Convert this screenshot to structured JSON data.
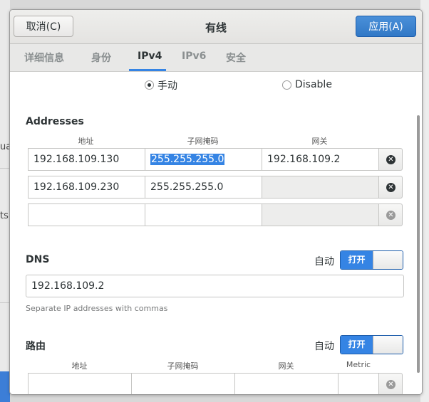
{
  "background": {
    "fragments": [
      "ua",
      "ts"
    ]
  },
  "dialog": {
    "title": "有线",
    "cancel_label": "取消(C)",
    "apply_label": "应用(A)"
  },
  "tabs": [
    {
      "label": "详细信息",
      "active": false
    },
    {
      "label": "身份",
      "active": false
    },
    {
      "label": "IPv4",
      "active": true
    },
    {
      "label": "IPv6",
      "active": false
    },
    {
      "label": "安全",
      "active": false
    }
  ],
  "method": {
    "manual_label": "手动",
    "disable_label": "Disable",
    "selected": "manual"
  },
  "addresses": {
    "title": "Addresses",
    "headers": [
      "地址",
      "子网掩码",
      "网关"
    ],
    "rows": [
      {
        "address": "192.168.109.130",
        "netmask": "255.255.255.0",
        "gateway": "192.168.109.2"
      },
      {
        "address": "192.168.109.230",
        "netmask": "255.255.255.0",
        "gateway": ""
      },
      {
        "address": "",
        "netmask": "",
        "gateway": ""
      }
    ]
  },
  "dns": {
    "title": "DNS",
    "auto_label": "自动",
    "switch_label": "打开",
    "value": "192.168.109.2",
    "hint": "Separate IP addresses with commas"
  },
  "routes": {
    "title": "路由",
    "auto_label": "自动",
    "switch_label": "打开",
    "headers": [
      "地址",
      "子网掩码",
      "网关",
      "Metric"
    ]
  },
  "colors": {
    "accent": "#3584e4",
    "selection": "#3584e4"
  }
}
